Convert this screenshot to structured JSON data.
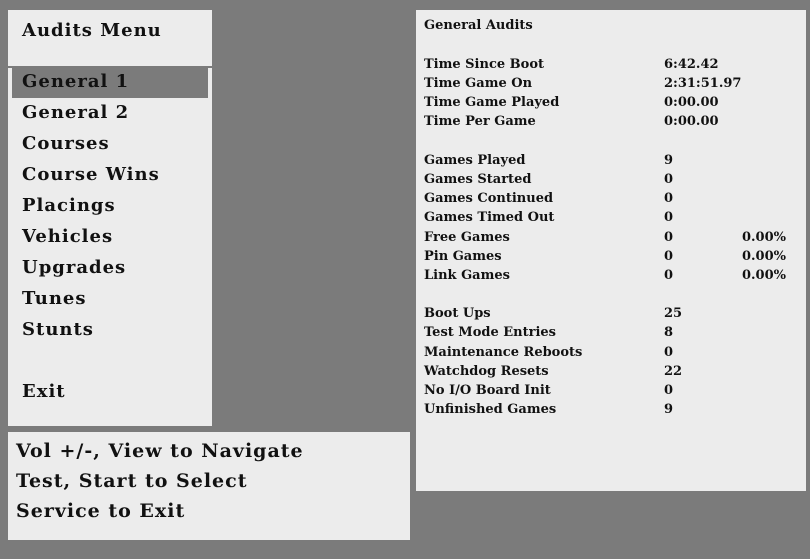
{
  "menu": {
    "title": "Audits Menu",
    "items": [
      {
        "label": "General 1",
        "selected": true
      },
      {
        "label": "General 2"
      },
      {
        "label": "Courses"
      },
      {
        "label": "Course Wins"
      },
      {
        "label": "Placings"
      },
      {
        "label": "Vehicles"
      },
      {
        "label": "Upgrades"
      },
      {
        "label": "Tunes"
      },
      {
        "label": "Stunts"
      },
      {
        "label": "Exit"
      }
    ]
  },
  "help": {
    "lines": [
      "Vol +/-, View to Navigate",
      "Test, Start to Select",
      "Service to Exit"
    ]
  },
  "audits": {
    "title": "General Audits",
    "rows": [
      {
        "label": "Time Since Boot",
        "value": "6:42.42"
      },
      {
        "label": "Time Game On",
        "value": "2:31:51.97"
      },
      {
        "label": "Time Game Played",
        "value": "0:00.00"
      },
      {
        "label": "Time Per Game",
        "value": "0:00.00"
      },
      {
        "label": "Games Played",
        "value": "9"
      },
      {
        "label": "Games Started",
        "value": "0"
      },
      {
        "label": "Games Continued",
        "value": "0"
      },
      {
        "label": "Games Timed Out",
        "value": "0"
      },
      {
        "label": "Free Games",
        "value": "0",
        "percent": "0.00%"
      },
      {
        "label": "Pin Games",
        "value": "0",
        "percent": "0.00%"
      },
      {
        "label": "Link Games",
        "value": "0",
        "percent": "0.00%"
      },
      {
        "label": "Boot Ups",
        "value": "25"
      },
      {
        "label": "Test Mode Entries",
        "value": "8"
      },
      {
        "label": "Maintenance Reboots",
        "value": "0"
      },
      {
        "label": "Watchdog Resets",
        "value": "22"
      },
      {
        "label": "No I/O Board Init",
        "value": "0"
      },
      {
        "label": "Unfinished Games",
        "value": "9"
      }
    ]
  }
}
